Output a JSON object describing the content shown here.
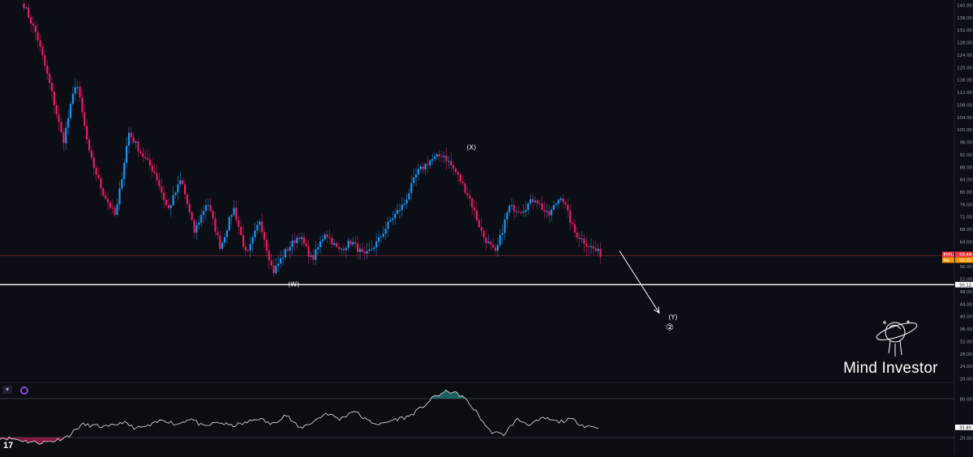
{
  "chart_data": {
    "type": "candlestick",
    "ticker": "PYPL",
    "last_price": "59.44",
    "price_axis": {
      "min": 20,
      "max": 140,
      "step": 4,
      "labels": [
        "140.00",
        "136.00",
        "132.00",
        "128.00",
        "124.00",
        "120.00",
        "116.00",
        "112.00",
        "108.00",
        "104.00",
        "100.00",
        "96.00",
        "92.00",
        "88.00",
        "84.00",
        "80.00",
        "76.00",
        "72.00",
        "68.00",
        "64.00",
        "60.00",
        "56.00",
        "52.00",
        "48.00",
        "44.00",
        "40.00",
        "36.00",
        "32.00",
        "28.00",
        "24.00",
        "20.00"
      ]
    },
    "price_tags": [
      {
        "label": "PYPL",
        "value": "59.44",
        "color": "#f23645"
      },
      {
        "label": "Ma",
        "value": "59.01",
        "color": "#ff9800"
      },
      {
        "label": "",
        "value": "50.12",
        "color": "#ffffff"
      }
    ],
    "support_level": 50.12,
    "path_waypoints": [
      140,
      130,
      114,
      96,
      116,
      92,
      80,
      72,
      99,
      92,
      86,
      74,
      84,
      67,
      77,
      62,
      75,
      59,
      71,
      54,
      61,
      66,
      58,
      67,
      61,
      64,
      59,
      64,
      71,
      76,
      86,
      90,
      92,
      86,
      78,
      66,
      60,
      75,
      74,
      78,
      72,
      79,
      67,
      63,
      60
    ],
    "annotations": [
      {
        "label": "(W)",
        "price": 49.5,
        "bar_fraction": 0.468
      },
      {
        "label": "(X)",
        "price": 93.5,
        "bar_fraction": 0.775
      },
      {
        "label": "(Y)",
        "price": 39.0
      },
      {
        "label": "②",
        "price": 35.5
      }
    ],
    "projection": {
      "from_price": 61.0,
      "to_price": 41.0
    },
    "oscillator": {
      "axis_labels": [
        "80.00",
        "35.80",
        "20.00"
      ],
      "upper_band": 80,
      "lower_band": 20,
      "current": 35.8,
      "waypoints": [
        20,
        18,
        14,
        12,
        15,
        22,
        40,
        38,
        36,
        44,
        34,
        38,
        48,
        40,
        50,
        36,
        44,
        38,
        42,
        50,
        40,
        56,
        34,
        44,
        58,
        48,
        62,
        46,
        40,
        48,
        52,
        66,
        84,
        92,
        84,
        60,
        30,
        24,
        48,
        40,
        50,
        44,
        48,
        38,
        36
      ]
    },
    "colors": {
      "up": "#2196f3",
      "down": "#e91e63",
      "background": "#0c0e15"
    }
  },
  "branding": {
    "name": "Mind Investor",
    "logo_text": "17"
  }
}
